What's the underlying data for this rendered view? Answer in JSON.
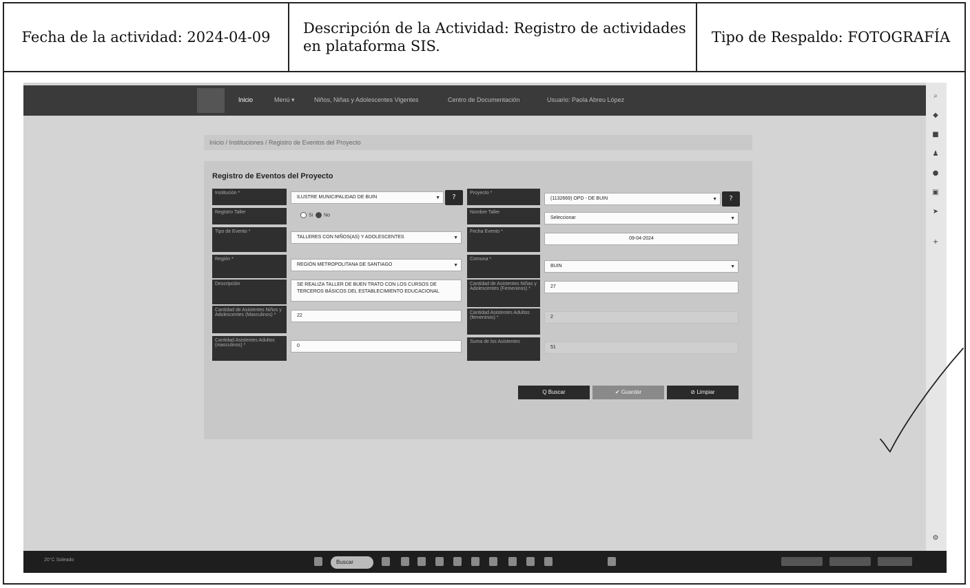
{
  "header": {
    "fecha": "Fecha de la actividad: 2024-04-09",
    "descripcion": "Descripción de la Actividad: Registro de actividades en plataforma SIS.",
    "tipo": "Tipo de Respaldo: FOTOGRAFÍA"
  },
  "screenshot": {
    "nav": {
      "inicio": "Inicio",
      "menu": "Menú ▾",
      "ninos": "Niños, Niñas y Adolescentes Vigentes",
      "centro": "Centro de Documentación",
      "usuario": "Usuario: Paola Abreu López"
    },
    "breadcrumb": "Inicio / Instituciones / Registro de Eventos del Proyecto",
    "form_title": "Registro de Eventos del Proyecto",
    "fields": {
      "institucion_label": "Institución *",
      "institucion_value": "ILUSTRE MUNICIPALIDAD DE BUIN",
      "proyecto_label": "Proyecto *",
      "proyecto_value": "(1132669) OPD - DE BUIN",
      "taller_label": "Registro Taller",
      "radio_si": "Si",
      "radio_no": "No",
      "nombre_taller_label": "Nombre Taller",
      "nombre_taller_value": "Seleccionar",
      "tipo_evento_label": "Tipo de Evento *",
      "tipo_evento_value": "TALLERES CON NIÑOS(AS) Y ADOLESCENTES",
      "fecha_evento_label": "Fecha Evento *",
      "fecha_evento_value": "09-04-2024",
      "region_label": "Región *",
      "region_value": "REGIÓN METROPOLITANA DE SANTIAGO",
      "comuna_label": "Comuna *",
      "comuna_value": "BUIN",
      "descripcion_label": "Descripción",
      "descripcion_value": "SE REALIZA TALLER DE BUEN TRATO CON LOS CURSOS DE TERCEROS BÁSICOS DEL ESTABLECIMIENTO EDUCACIONAL",
      "asist_fem_label": "Cantidad de Asistentes Niñas y Adolescentes (Femeninos) *",
      "asist_fem_value": "27",
      "asist_masc_label": "Cantidad de Asistentes Niños y Adolescentes (Masculinos) *",
      "asist_masc_value": "22",
      "adultos_fem_label": "Cantidad Asistentes Adultos (femeninos) *",
      "adultos_fem_value": "2",
      "adultos_masc_label": "Cantidad Asistentes Adultos (masculinos) *",
      "adultos_masc_value": "0",
      "suma_label": "Suma de los Asistentes",
      "suma_value": "51"
    },
    "buttons": {
      "buscar": "Q Buscar",
      "guardar": "✔ Guardar",
      "limpiar": "⊘ Limpiar"
    },
    "taskbar": {
      "weather": "20°C Soleado",
      "search": "Buscar"
    }
  },
  "colors": {
    "nav_bg": "#3a3a3a",
    "label_bg": "#2f2f2f",
    "page_bg": "#d4d4d4"
  }
}
